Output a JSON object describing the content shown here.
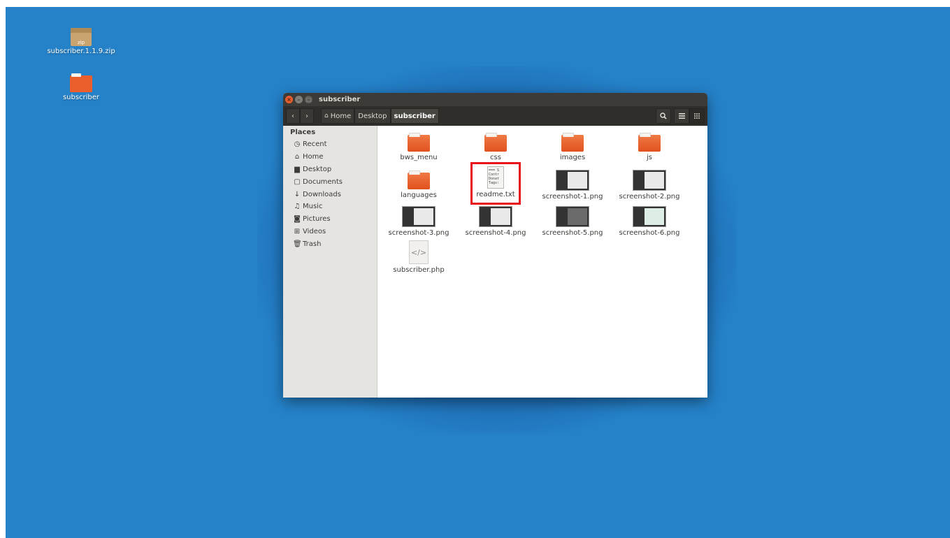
{
  "desktop": {
    "icons": [
      {
        "label": "subscriber.1.1.9.zip",
        "type": "zip",
        "badge": "zip"
      },
      {
        "label": "subscriber",
        "type": "folder"
      }
    ]
  },
  "window": {
    "title": "subscriber",
    "controls": {
      "close": "×",
      "minimize": "–",
      "maximize": "□"
    },
    "toolbar": {
      "back": "‹",
      "forward": "›",
      "breadcrumbs": [
        {
          "label": "Home",
          "icon": "home-icon"
        },
        {
          "label": "Desktop"
        },
        {
          "label": "subscriber",
          "active": true
        }
      ],
      "search_icon": "search-icon",
      "list_view_icon": "list-icon",
      "grid_view_icon": "grid-icon"
    },
    "sidebar": {
      "heading": "Places",
      "items": [
        {
          "label": "Recent",
          "icon": "clock-icon"
        },
        {
          "label": "Home",
          "icon": "home-icon"
        },
        {
          "label": "Desktop",
          "icon": "folder-icon"
        },
        {
          "label": "Documents",
          "icon": "document-icon"
        },
        {
          "label": "Downloads",
          "icon": "download-icon"
        },
        {
          "label": "Music",
          "icon": "music-icon"
        },
        {
          "label": "Pictures",
          "icon": "camera-icon"
        },
        {
          "label": "Videos",
          "icon": "video-icon"
        },
        {
          "label": "Trash",
          "icon": "trash-icon"
        }
      ]
    },
    "files": [
      {
        "name": "bws_menu",
        "type": "folder"
      },
      {
        "name": "css",
        "type": "folder"
      },
      {
        "name": "images",
        "type": "folder"
      },
      {
        "name": "js",
        "type": "folder"
      },
      {
        "name": "languages",
        "type": "folder"
      },
      {
        "name": "readme.txt",
        "type": "text",
        "preview": "=== S\nContr\nDonat\nTags:",
        "highlighted": true
      },
      {
        "name": "screenshot-1.png",
        "type": "image",
        "pane": "light"
      },
      {
        "name": "screenshot-2.png",
        "type": "image",
        "pane": "light"
      },
      {
        "name": "screenshot-3.png",
        "type": "image",
        "pane": "light"
      },
      {
        "name": "screenshot-4.png",
        "type": "image",
        "pane": "light"
      },
      {
        "name": "screenshot-5.png",
        "type": "image",
        "pane": "dark"
      },
      {
        "name": "screenshot-6.png",
        "type": "image",
        "pane": "green"
      },
      {
        "name": "subscriber.php",
        "type": "code",
        "glyph": "</>"
      }
    ]
  },
  "colors": {
    "desktop_bg": "#2582c9",
    "folder_orange": "#e95e2a",
    "highlight_red": "#e8141c",
    "titlebar": "#3c3b37"
  }
}
